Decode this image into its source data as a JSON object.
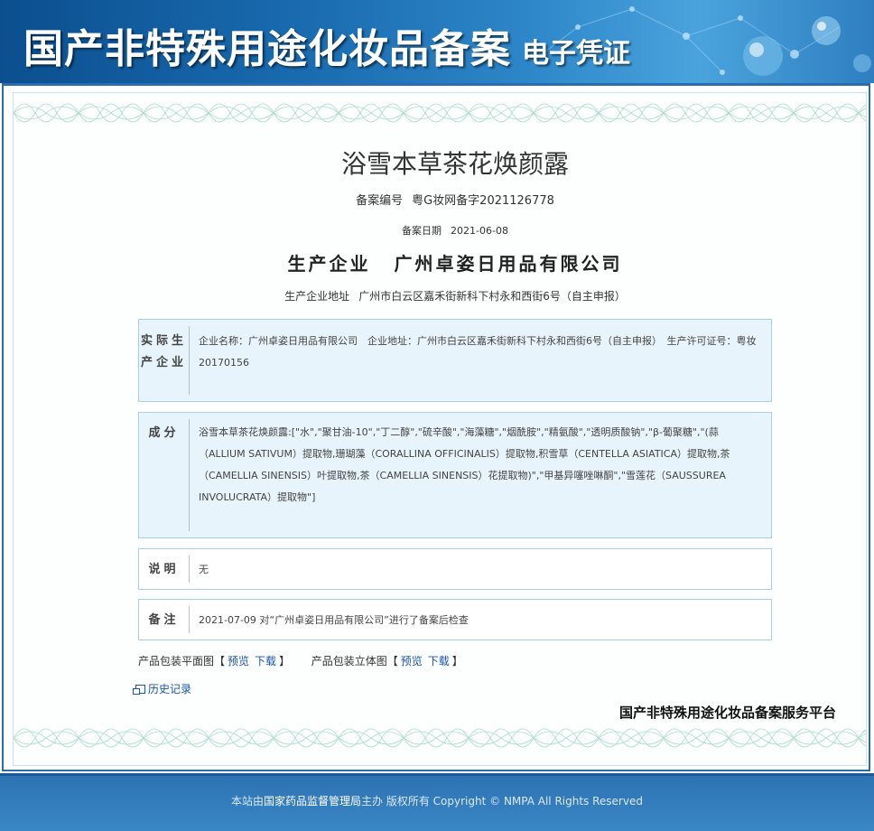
{
  "banner": {
    "title": "国产非特殊用途化妆品备案",
    "subtitle": "电子凭证"
  },
  "product": {
    "name": "浴雪本草茶花焕颜露",
    "reg_label": "备案编号",
    "reg_value": "粤G妆网备字2021126778",
    "date_label": "备案日期",
    "date_value": "2021-06-08",
    "company_label": "生产企业",
    "company_value": "广州卓姿日用品有限公司",
    "address_label": "生产企业地址",
    "address_value": "广州市白云区嘉禾街新科下村永和西街6号（自主申报）"
  },
  "sections": {
    "producer": {
      "label": "实际生产企业",
      "text": "企业名称：广州卓姿日用品有限公司　企业地址：广州市白云区嘉禾街新科下村永和西街6号（自主申报）　生产许可证号：粤妆20170156"
    },
    "ingredients": {
      "label": "成分",
      "text": "浴雪本草茶花焕颜露:[\"水\",\"聚甘油-10\",\"丁二醇\",\"硫辛酸\",\"海藻糖\",\"烟酰胺\",\"精氨酸\",\"透明质酸钠\",\"β-葡聚糖\",\"(蒜（ALLIUM SATIVUM）提取物,珊瑚藻（CORALLINA OFFICINALIS）提取物,积雪草（CENTELLA ASIATICA）提取物,茶（CAMELLIA SINENSIS）叶提取物,茶（CAMELLIA SINENSIS）花提取物)\",\"甲基异噻唑啉酮\",\"雪莲花（SAUSSUREA INVOLUCRATA）提取物\"]"
    },
    "note": {
      "label": "说明",
      "text": "无"
    },
    "remark": {
      "label": "备注",
      "text": "2021-07-09 对“广州卓姿日用品有限公司”进行了备案后检查"
    }
  },
  "package": {
    "flat_label": "产品包装平面图",
    "solid_label": "产品包装立体图",
    "preview": "预览",
    "download": "下载",
    "bracket_open": "【",
    "bracket_close": "】"
  },
  "history_link": "历史记录",
  "platform_text": "国产非特殊用途化妆品备案服务平台",
  "footer": {
    "prefix": "本站由",
    "org": "国家药品监督管理局",
    "suffix": "主办 版权所有 Copyright © NMPA All Rights Reserved"
  },
  "colors": {
    "banner_blue": "#1a6bb0",
    "box_blue": "#e8f4fb",
    "link_blue": "#1a55a8"
  }
}
